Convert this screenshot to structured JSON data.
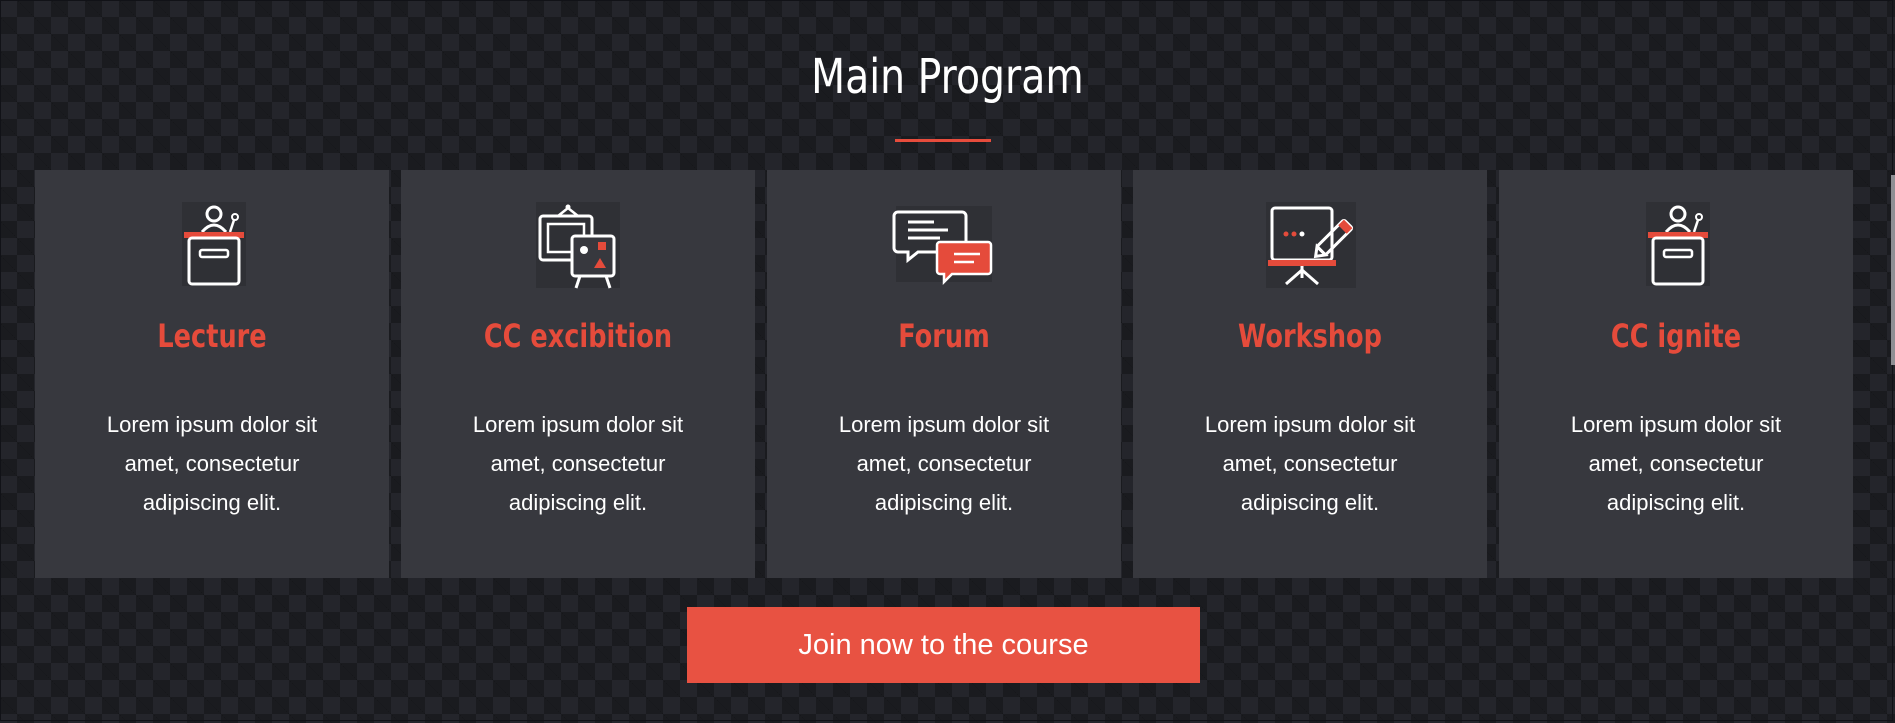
{
  "section": {
    "title": "Main Program"
  },
  "cards": [
    {
      "icon": "podium-icon",
      "title": "Lecture",
      "text": "Lorem ipsum dolor sit amet, consectetur adipiscing elit."
    },
    {
      "icon": "easel-presentation-icon",
      "title": "CC excibition",
      "text": "Lorem ipsum dolor sit amet, consectetur adipiscing elit."
    },
    {
      "icon": "chat-bubbles-icon",
      "title": "Forum",
      "text": "Lorem ipsum dolor sit amet, consectetur adipiscing elit."
    },
    {
      "icon": "whiteboard-marker-icon",
      "title": "Workshop",
      "text": "Lorem ipsum dolor sit amet, consectetur adipiscing elit."
    },
    {
      "icon": "podium-icon",
      "title": "CC ignite",
      "text": "Lorem ipsum dolor sit amet, consectetur adipiscing elit."
    }
  ],
  "cta": {
    "label": "Join now to the course"
  },
  "colors": {
    "accent": "#e74c3c",
    "background": "#24252b",
    "card": "#37383e"
  }
}
